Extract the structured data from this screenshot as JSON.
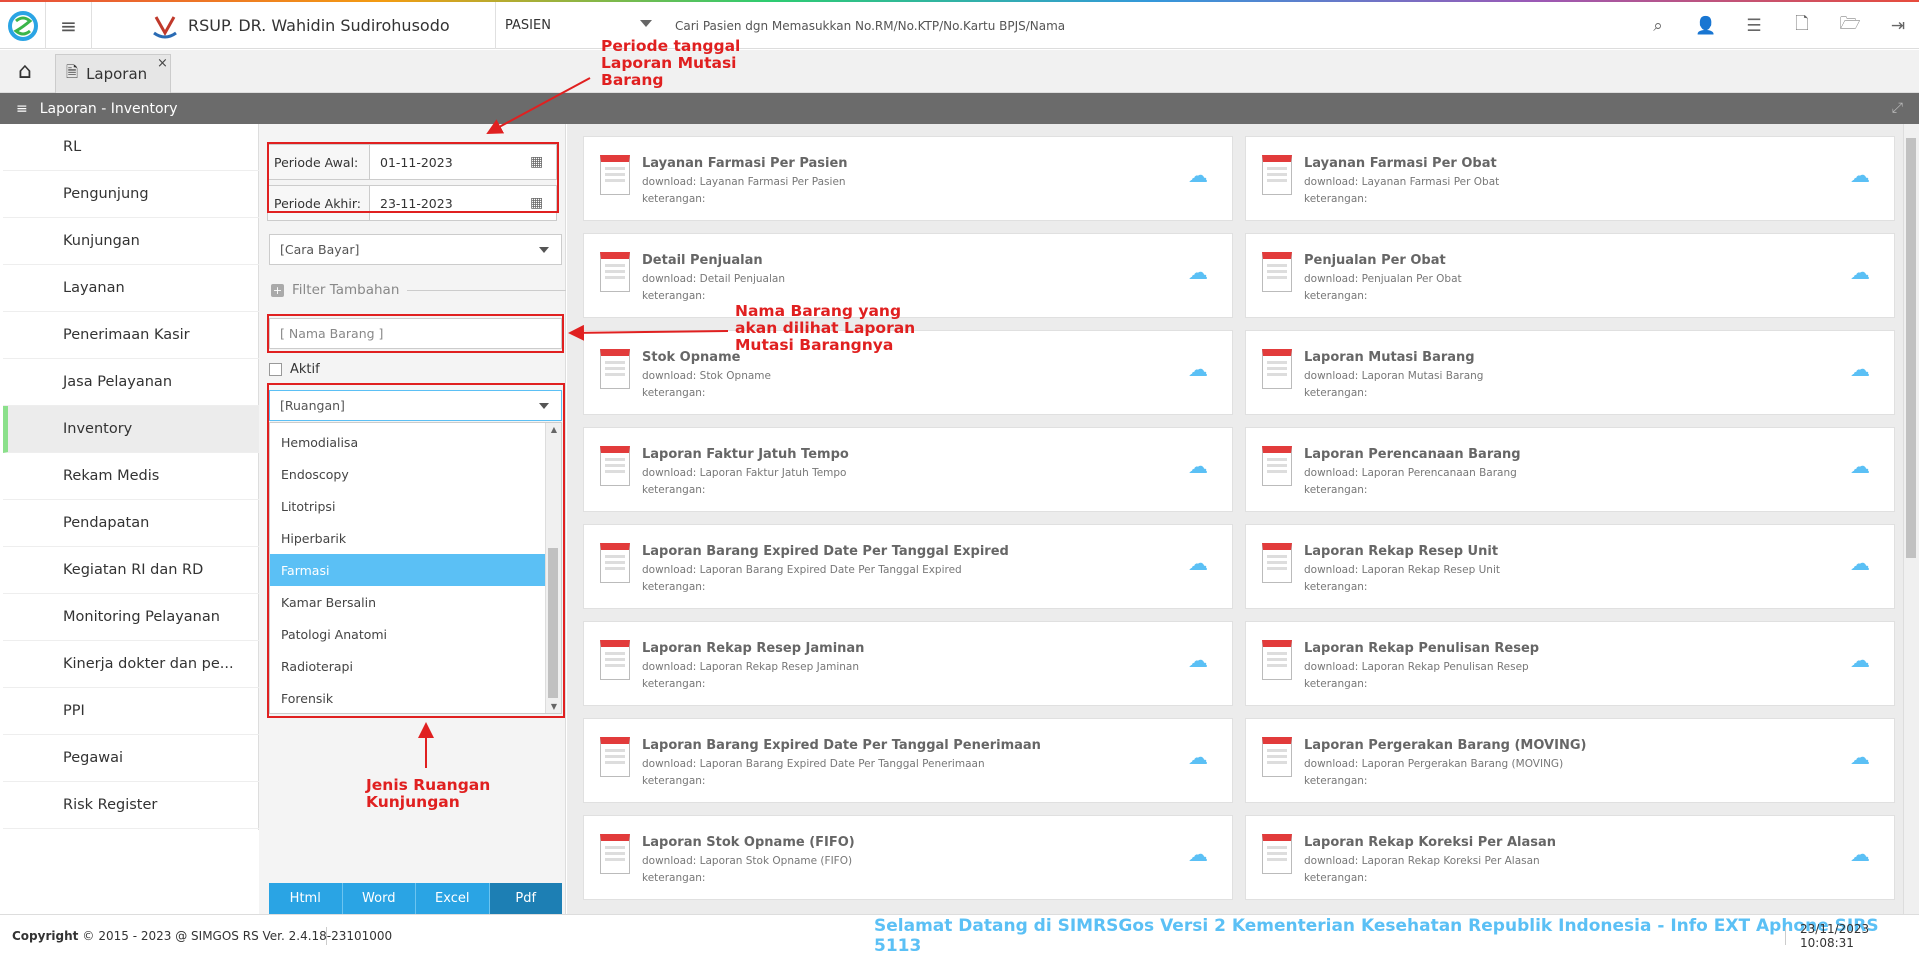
{
  "header": {
    "hospital_name": "RSUP. DR. Wahidin Sudirohusodo",
    "search_type": "PASIEN",
    "search_placeholder": "Cari Pasien dgn Memasukkan No.RM/No.KTP/No.Kartu BPJS/Nama",
    "icons": [
      "search-icon",
      "add-user-icon",
      "list-icon",
      "pdf-file-icon",
      "folder-open-icon",
      "sign-out-icon"
    ]
  },
  "tabs": [
    {
      "label": "Laporan",
      "close": "×"
    }
  ],
  "section_title": "Laporan - Inventory",
  "sidebar": {
    "items": [
      "RL",
      "Pengunjung",
      "Kunjungan",
      "Layanan",
      "Penerimaan Kasir",
      "Jasa Pelayanan",
      "Inventory",
      "Rekam Medis",
      "Pendapatan",
      "Kegiatan RI dan RD",
      "Monitoring Pelayanan",
      "Kinerja dokter dan pe...",
      "PPI",
      "Pegawai",
      "Risk Register"
    ],
    "active": "Inventory"
  },
  "filter": {
    "periode_awal_label": "Periode Awal:",
    "periode_awal_value": "01-11-2023",
    "periode_akhir_label": "Periode Akhir:",
    "periode_akhir_value": "23-11-2023",
    "cara_bayar": "[Cara Bayar]",
    "filter_tambahan": "Filter Tambahan",
    "nama_barang_placeholder": "[ Nama Barang ]",
    "aktif_label": "Aktif",
    "ruangan": "[Ruangan]",
    "ruangan_options": [
      "Hemodialisa",
      "Endoscopy",
      "Litotripsi",
      "Hiperbarik",
      "Farmasi",
      "Kamar Bersalin",
      "Patologi Anatomi",
      "Radioterapi",
      "Forensik"
    ],
    "ruangan_selected": "Farmasi",
    "buttons": [
      "Html",
      "Word",
      "Excel",
      "Pdf"
    ]
  },
  "reports": {
    "keterangan_label": "keterangan:",
    "left": [
      {
        "title": "Layanan Farmasi Per Pasien",
        "download": "download: Layanan Farmasi Per Pasien"
      },
      {
        "title": "Detail Penjualan",
        "download": "download: Detail Penjualan"
      },
      {
        "title": "Stok Opname",
        "download": "download: Stok Opname"
      },
      {
        "title": "Laporan Faktur Jatuh Tempo",
        "download": "download: Laporan Faktur Jatuh Tempo"
      },
      {
        "title": "Laporan Barang Expired Date Per Tanggal Expired",
        "download": "download: Laporan Barang Expired Date Per Tanggal Expired"
      },
      {
        "title": "Laporan Rekap Resep Jaminan",
        "download": "download: Laporan Rekap Resep Jaminan"
      },
      {
        "title": "Laporan Barang Expired Date Per Tanggal Penerimaan",
        "download": "download: Laporan Barang Expired Date Per Tanggal Penerimaan"
      },
      {
        "title": "Laporan Stok Opname (FIFO)",
        "download": "download: Laporan Stok Opname (FIFO)"
      }
    ],
    "right": [
      {
        "title": "Layanan Farmasi Per Obat",
        "download": "download: Layanan Farmasi Per Obat"
      },
      {
        "title": "Penjualan Per Obat",
        "download": "download: Penjualan Per Obat"
      },
      {
        "title": "Laporan Mutasi Barang",
        "download": "download: Laporan Mutasi Barang"
      },
      {
        "title": "Laporan Perencanaan Barang",
        "download": "download: Laporan Perencanaan Barang"
      },
      {
        "title": "Laporan Rekap Resep Unit",
        "download": "download: Laporan Rekap Resep Unit"
      },
      {
        "title": "Laporan Rekap Penulisan Resep",
        "download": "download: Laporan Rekap Penulisan Resep"
      },
      {
        "title": "Laporan Pergerakan Barang (MOVING)",
        "download": "download: Laporan Pergerakan Barang (MOVING)"
      },
      {
        "title": "Laporan Rekap Koreksi Per Alasan",
        "download": "download: Laporan Rekap Koreksi Per Alasan"
      }
    ]
  },
  "annotations": {
    "periode": "Periode tanggal\nLaporan Mutasi\nBarang",
    "nama_barang": "Nama Barang yang\nakan dilihat Laporan\nMutasi Barangnya",
    "ruangan": "Jenis Ruangan\nKunjungan"
  },
  "footer": {
    "copyright_label": "Copyright",
    "copyright_text": "2015 - 2023 @ SIMGOS RS Ver. 2.4.18-23101000",
    "welcome": "Selamat Datang di SIMRSGos Versi 2 Kementerian Kesehatan Republik Indonesia - Info EXT Aphone SIRS 5113",
    "datetime": "23/11/2023 10:08:31"
  },
  "colors": {
    "accent": "#5bc0f5",
    "section_bar": "#6b6b6b",
    "annotation": "#e02020",
    "btn": "#2aa4e4"
  }
}
